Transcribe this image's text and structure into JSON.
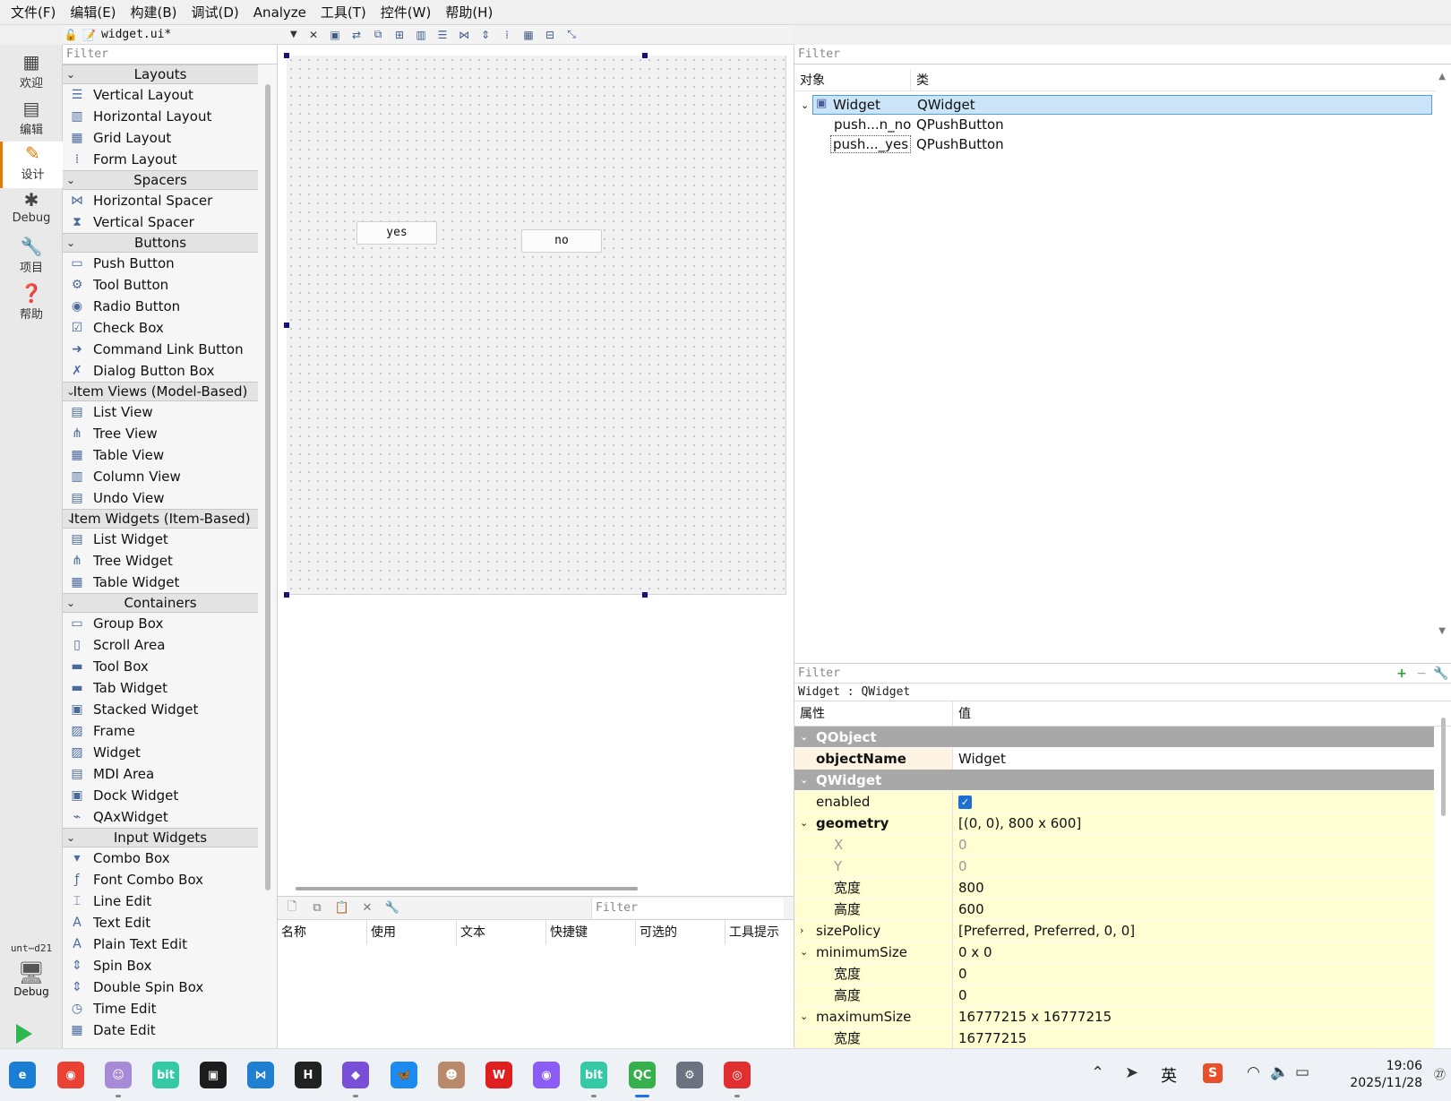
{
  "menubar": [
    "文件(F)",
    "编辑(E)",
    "构建(B)",
    "调试(D)",
    "Analyze",
    "工具(T)",
    "控件(W)",
    "帮助(H)"
  ],
  "modes": [
    {
      "label": "欢迎",
      "icon": "grid-icon"
    },
    {
      "label": "编辑",
      "icon": "document-icon"
    },
    {
      "label": "设计",
      "icon": "pencil-icon",
      "active": true
    },
    {
      "label": "Debug",
      "icon": "bug-icon"
    },
    {
      "label": "项目",
      "icon": "wrench-icon"
    },
    {
      "label": "帮助",
      "icon": "help-icon"
    }
  ],
  "target": {
    "name": "unt⋯d21",
    "mode": "Debug"
  },
  "editor": {
    "file": "widget.ui*"
  },
  "widgetbox": {
    "filter_placeholder": "Filter",
    "categories": [
      {
        "title": "Layouts",
        "items": [
          "Vertical Layout",
          "Horizontal Layout",
          "Grid Layout",
          "Form Layout"
        ]
      },
      {
        "title": "Spacers",
        "items": [
          "Horizontal Spacer",
          "Vertical Spacer"
        ]
      },
      {
        "title": "Buttons",
        "items": [
          "Push Button",
          "Tool Button",
          "Radio Button",
          "Check Box",
          "Command Link Button",
          "Dialog Button Box"
        ]
      },
      {
        "title": "Item Views (Model-Based)",
        "items": [
          "List View",
          "Tree View",
          "Table View",
          "Column View",
          "Undo View"
        ]
      },
      {
        "title": "Item Widgets (Item-Based)",
        "items": [
          "List Widget",
          "Tree Widget",
          "Table Widget"
        ]
      },
      {
        "title": "Containers",
        "items": [
          "Group Box",
          "Scroll Area",
          "Tool Box",
          "Tab Widget",
          "Stacked Widget",
          "Frame",
          "Widget",
          "MDI Area",
          "Dock Widget",
          "QAxWidget"
        ]
      },
      {
        "title": "Input Widgets",
        "items": [
          "Combo Box",
          "Font Combo Box",
          "Line Edit",
          "Text Edit",
          "Plain Text Edit",
          "Spin Box",
          "Double Spin Box",
          "Time Edit",
          "Date Edit"
        ]
      }
    ]
  },
  "form": {
    "btn_yes": "yes",
    "btn_no": "no"
  },
  "action_editor": {
    "filter_placeholder": "Filter",
    "columns": [
      "名称",
      "使用",
      "文本",
      "快捷键",
      "可选的",
      "工具提示"
    ]
  },
  "object_inspector": {
    "filter_placeholder": "Filter",
    "col_object": "对象",
    "col_class": "类",
    "rows": [
      {
        "name": "Widget",
        "class": "QWidget"
      },
      {
        "name": "push...n_no",
        "class": "QPushButton"
      },
      {
        "name": "push..._yes",
        "class": "QPushButton"
      }
    ]
  },
  "property_editor": {
    "filter_placeholder": "Filter",
    "class_label": "Widget : QWidget",
    "col_prop": "属性",
    "col_value": "值",
    "rows": [
      {
        "kind": "sec",
        "key": "QObject"
      },
      {
        "kind": "or",
        "key": "objectName",
        "value": "Widget",
        "bold": true
      },
      {
        "kind": "sec",
        "key": "QWidget"
      },
      {
        "kind": "yl",
        "key": "enabled",
        "value": "",
        "checkbox": true
      },
      {
        "kind": "yl",
        "key": "geometry",
        "value": "[(0, 0), 800 x 600]",
        "bold": true,
        "expand": "open"
      },
      {
        "kind": "yl sub dim",
        "key": "X",
        "value": "0"
      },
      {
        "kind": "yl sub dim",
        "key": "Y",
        "value": "0"
      },
      {
        "kind": "yl sub",
        "key": "宽度",
        "value": "800"
      },
      {
        "kind": "yl sub",
        "key": "高度",
        "value": "600"
      },
      {
        "kind": "yl",
        "key": "sizePolicy",
        "value": "[Preferred, Preferred, 0, 0]",
        "expand": "closed"
      },
      {
        "kind": "yl",
        "key": "minimumSize",
        "value": "0 x 0",
        "expand": "open"
      },
      {
        "kind": "yl sub",
        "key": "宽度",
        "value": "0"
      },
      {
        "kind": "yl sub",
        "key": "高度",
        "value": "0"
      },
      {
        "kind": "yl",
        "key": "maximumSize",
        "value": "16777215 x 16777215",
        "expand": "open"
      },
      {
        "kind": "yl sub",
        "key": "宽度",
        "value": "16777215"
      }
    ]
  },
  "taskbar": {
    "apps": [
      "edge",
      "chrome",
      "avatar-app",
      "bit-app",
      "terminal-app",
      "vscode",
      "h-app",
      "obsidian",
      "bluesky",
      "character-app",
      "wps",
      "chat-app",
      "bit-app-2",
      "qt-creator",
      "settings",
      "netease-music"
    ],
    "ime": "英",
    "time": "19:06",
    "date": "2025/11/28"
  },
  "colors": {
    "accent": "#e07b00",
    "selection": "#cce4f7",
    "section": "#a8a8a8",
    "changed": "#fffed2"
  }
}
